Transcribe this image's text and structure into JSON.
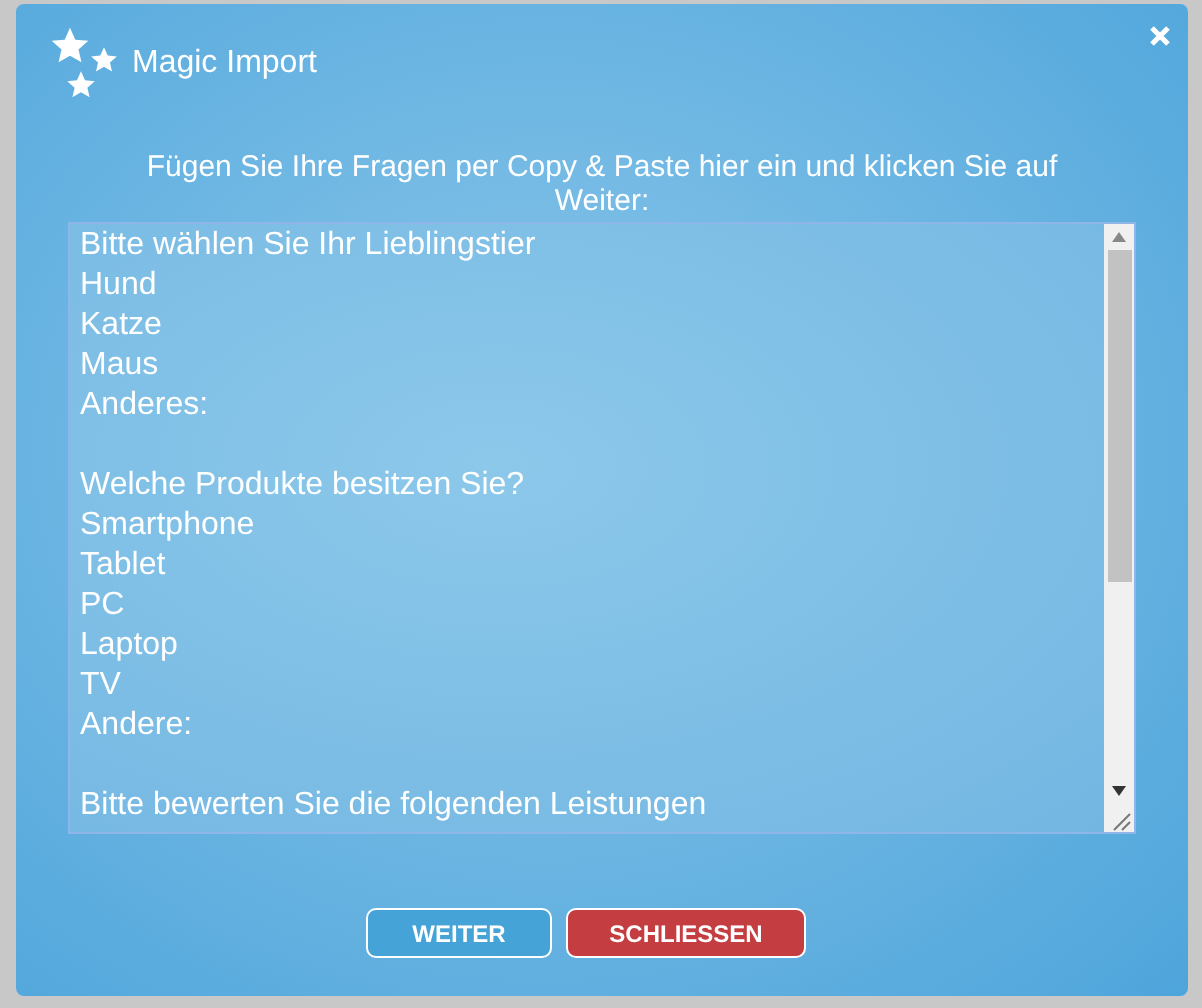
{
  "dialog": {
    "title": "Magic Import",
    "instruction": "Fügen Sie Ihre Fragen per Copy & Paste hier ein und klicken Sie auf Weiter:"
  },
  "paste_field": {
    "blocks": [
      {
        "lines": [
          "Bitte wählen Sie Ihr Lieblingstier",
          "Hund",
          "Katze",
          "Maus",
          "Anderes:"
        ]
      },
      {
        "lines": [
          "Welche Produkte besitzen Sie?",
          "Smartphone",
          "Tablet",
          "PC",
          "Laptop",
          "TV",
          "Andere:"
        ]
      },
      {
        "lines": [
          "Bitte bewerten Sie die folgenden Leistungen"
        ]
      }
    ]
  },
  "buttons": [
    {
      "label": "WEITER",
      "kind": "primary"
    },
    {
      "label": "SCHLIESSEN",
      "kind": "danger"
    }
  ]
}
